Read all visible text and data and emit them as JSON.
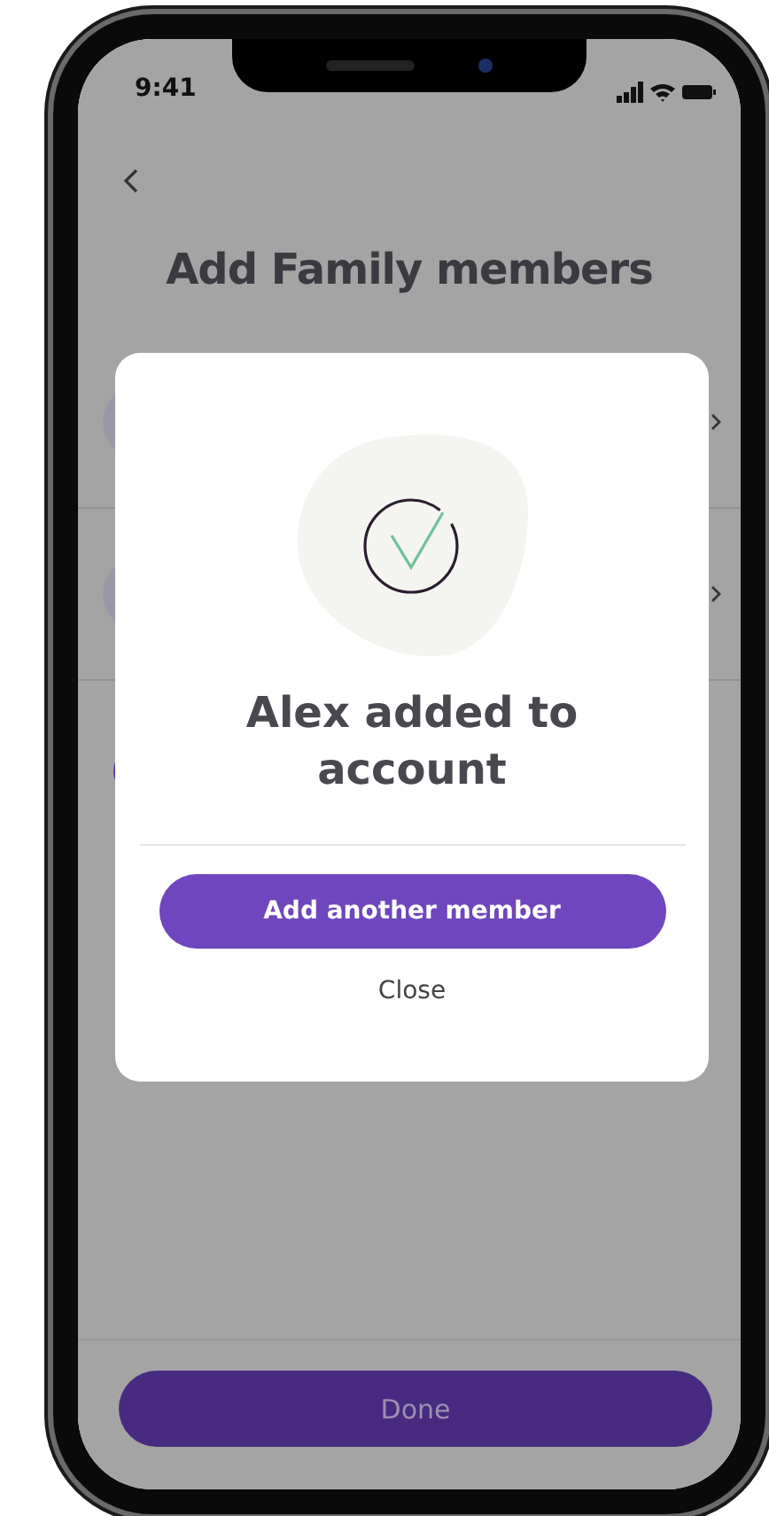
{
  "status_bar": {
    "time": "9:41"
  },
  "header": {
    "title": "Add Family members"
  },
  "dialog": {
    "title": "Alex added to account",
    "primary_button": "Add another member",
    "secondary_button": "Close"
  },
  "footer": {
    "button": "Done"
  }
}
